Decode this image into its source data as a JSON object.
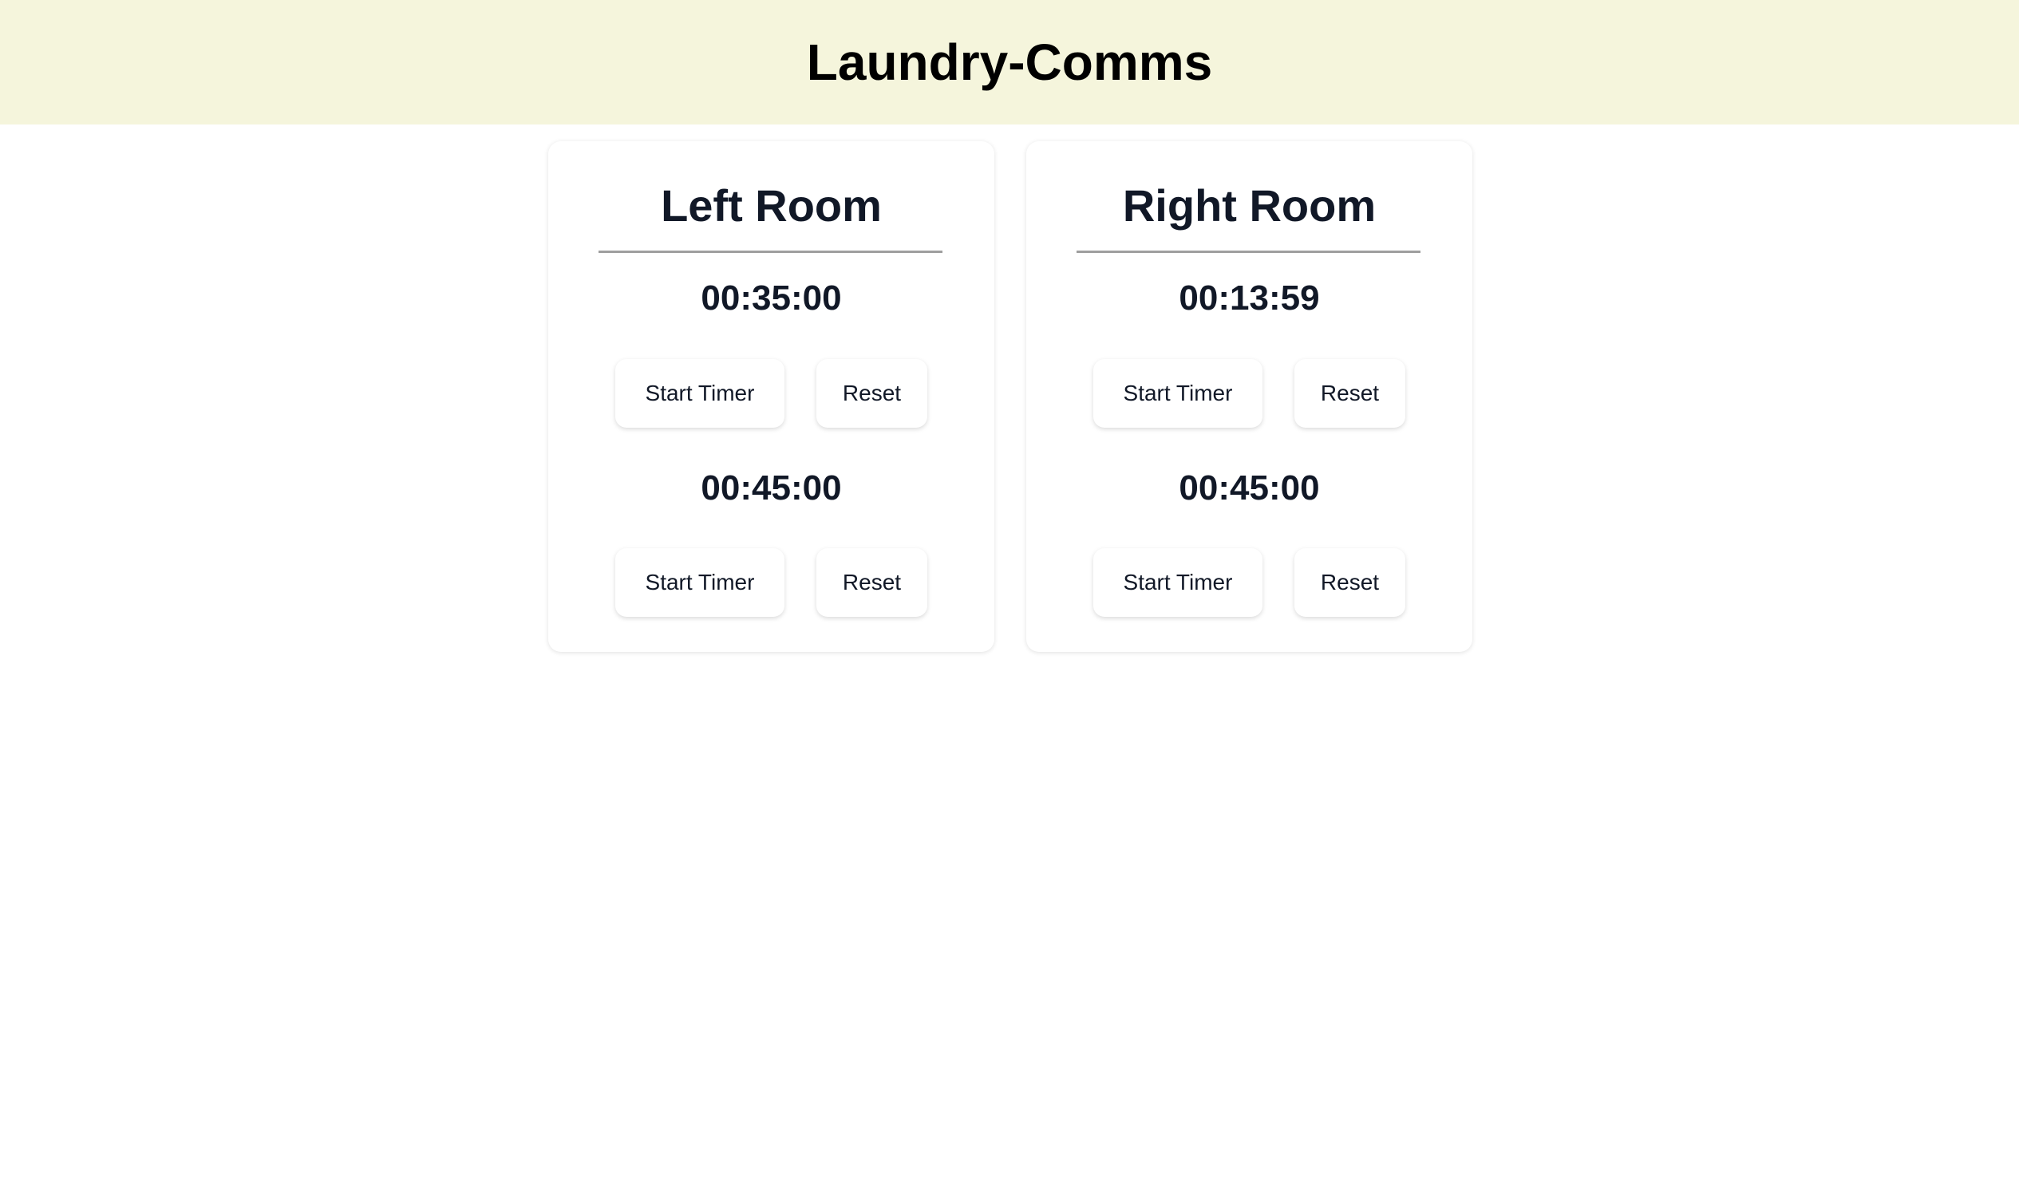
{
  "header": {
    "title": "Laundry-Comms"
  },
  "rooms": [
    {
      "title": "Left Room",
      "timers": [
        {
          "value": "00:35:00",
          "start_label": "Start Timer",
          "reset_label": "Reset"
        },
        {
          "value": "00:45:00",
          "start_label": "Start Timer",
          "reset_label": "Reset"
        }
      ]
    },
    {
      "title": "Right Room",
      "timers": [
        {
          "value": "00:13:59",
          "start_label": "Start Timer",
          "reset_label": "Reset"
        },
        {
          "value": "00:45:00",
          "start_label": "Start Timer",
          "reset_label": "Reset"
        }
      ]
    }
  ]
}
